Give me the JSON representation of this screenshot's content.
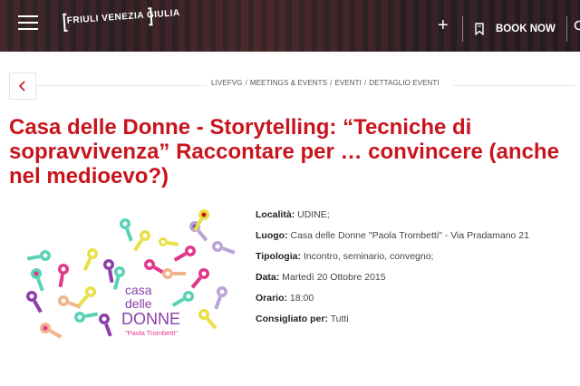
{
  "header": {
    "logo_text": "FRIULI VENEZIA GIULIA",
    "plus_label": "+",
    "book_now_label": "BOOK NOW"
  },
  "breadcrumb": {
    "items": [
      "LIVEFVG",
      "MEETINGS & EVENTS",
      "EVENTI",
      "DETTAGLIO EVENTI"
    ],
    "separator": "/"
  },
  "event": {
    "title": "Casa delle Donne - Storytelling: “Tecniche di sopravvivenza” Raccontare per … convincere (anche nel medioevo?)",
    "details": [
      {
        "label": "Località:",
        "value": " UDINE;"
      },
      {
        "label": "Luogo:",
        "value": " Casa delle Donne \"Paola Trombetti\" - Via Pradamano 21"
      },
      {
        "label": "Tipologia:",
        "value": " Incontro, seminario, convegno;"
      },
      {
        "label": "Data:",
        "value": " Martedì 20 Ottobre 2015"
      },
      {
        "label": "Orario:",
        "value": " 18:00"
      },
      {
        "label": "Consigliato per:",
        "value": " Tutti"
      }
    ]
  },
  "poster": {
    "line1": "casa",
    "line2": "delle",
    "line3": "DONNE",
    "subtitle": "\"Paola Trombetti\""
  },
  "colors": {
    "title_red": "#c8151d",
    "poster_purple": "#8a3fa8"
  },
  "icons": {
    "menu": "hamburger-icon",
    "back": "chevron-left-icon",
    "book": "bookmark-icon",
    "search": "search-icon"
  }
}
